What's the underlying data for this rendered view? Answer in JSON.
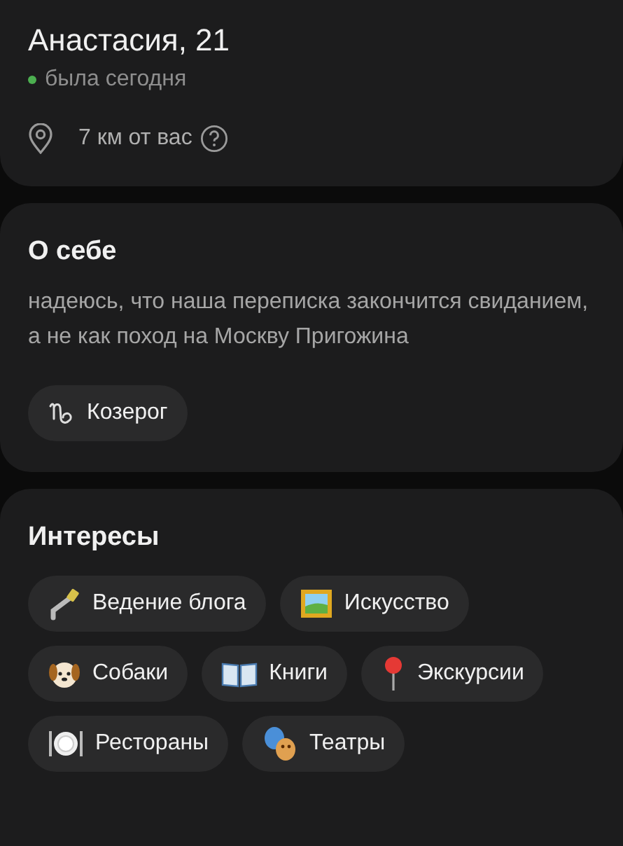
{
  "profile": {
    "name": "Анастасия, 21",
    "status": "была сегодня",
    "online": true,
    "distance": "7 км от вас"
  },
  "about": {
    "title": "О себе",
    "text": "надеюсь, что наша переписка закончится свиданием, а не как поход на Москву Пригожина",
    "zodiac": "Козерог"
  },
  "interests": {
    "title": "Интересы",
    "items": [
      {
        "label": "Ведение блога",
        "kind": "selfie"
      },
      {
        "label": "Искусство",
        "kind": "painting"
      },
      {
        "label": "Собаки",
        "kind": "dog"
      },
      {
        "label": "Книги",
        "kind": "book"
      },
      {
        "label": "Экскурсии",
        "kind": "pin"
      },
      {
        "label": "Рестораны",
        "kind": "plate"
      },
      {
        "label": "Театры",
        "kind": "masks"
      }
    ]
  }
}
